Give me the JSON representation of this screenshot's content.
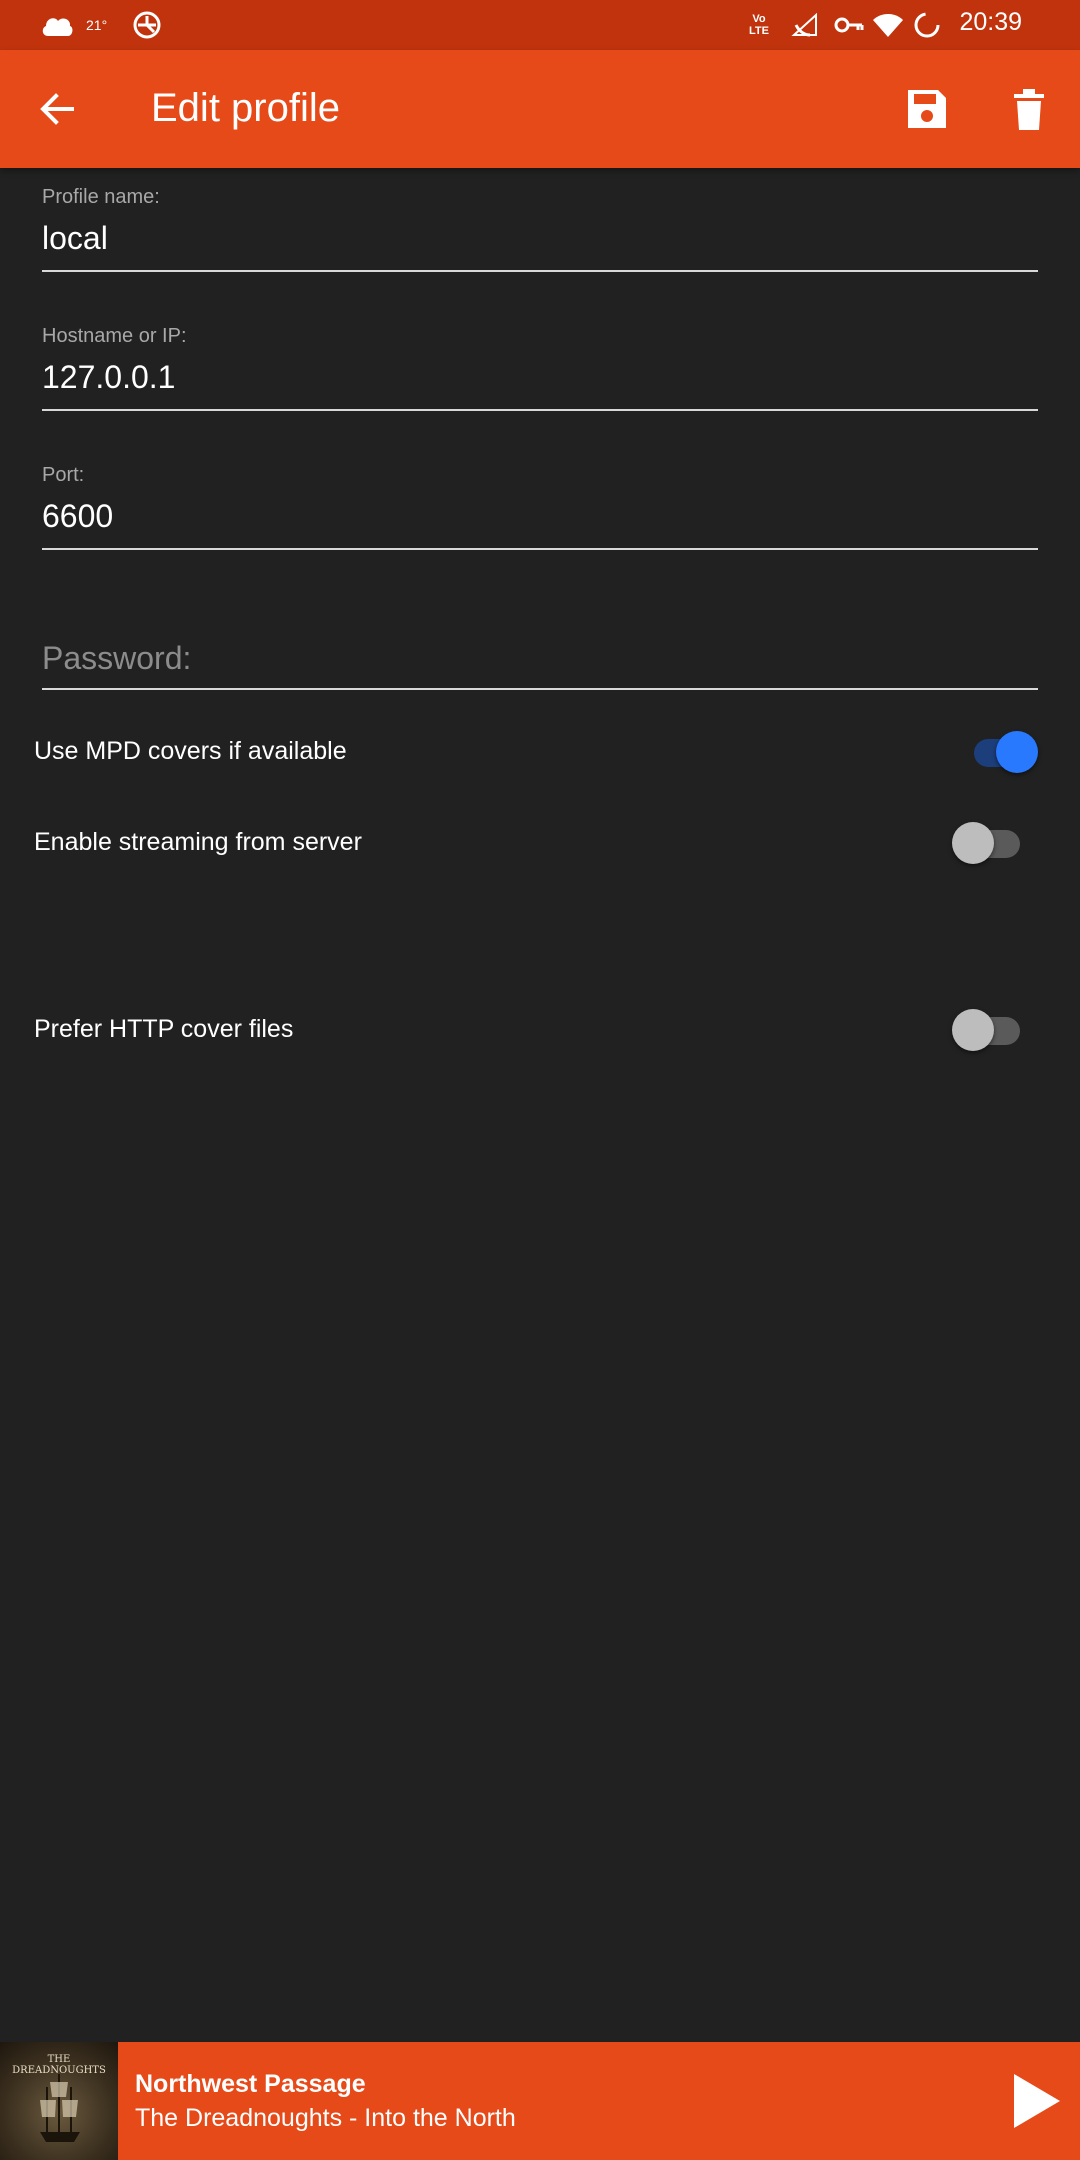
{
  "status_bar": {
    "time": "20:39",
    "temperature": "21°",
    "icons": [
      "cloud-icon",
      "temperature-icon",
      "sync-icon",
      "volte-icon",
      "wifi-calling-icon",
      "vpn-key-icon",
      "wifi-icon",
      "battery-icon"
    ],
    "volte_label": "Vo LTE"
  },
  "app_bar": {
    "title": "Edit profile",
    "back_icon": "arrow-back-icon",
    "save_icon": "save-icon",
    "delete_icon": "delete-icon",
    "background": "#e64a19"
  },
  "form": {
    "profile_name": {
      "label": "Profile name:",
      "value": "local"
    },
    "hostname": {
      "label": "Hostname or IP:",
      "value": "127.0.0.1"
    },
    "port": {
      "label": "Port:",
      "value": "6600"
    },
    "password": {
      "placeholder": "Password:",
      "value": ""
    }
  },
  "toggles": [
    {
      "label": "Use MPD covers if available",
      "checked": true
    },
    {
      "label": "Enable streaming from server",
      "checked": false
    },
    {
      "label": "Prefer HTTP cover files",
      "checked": false
    }
  ],
  "now_playing": {
    "title": "Northwest Passage",
    "subtitle": "The Dreadnoughts - Into the North",
    "cover_text": "THE DREADNOUGHTS",
    "play_icon": "play-icon"
  },
  "colors": {
    "primary": "#e64a19",
    "status_bar": "#c0330d",
    "background": "#212121",
    "switch_on": "#2979ff"
  }
}
